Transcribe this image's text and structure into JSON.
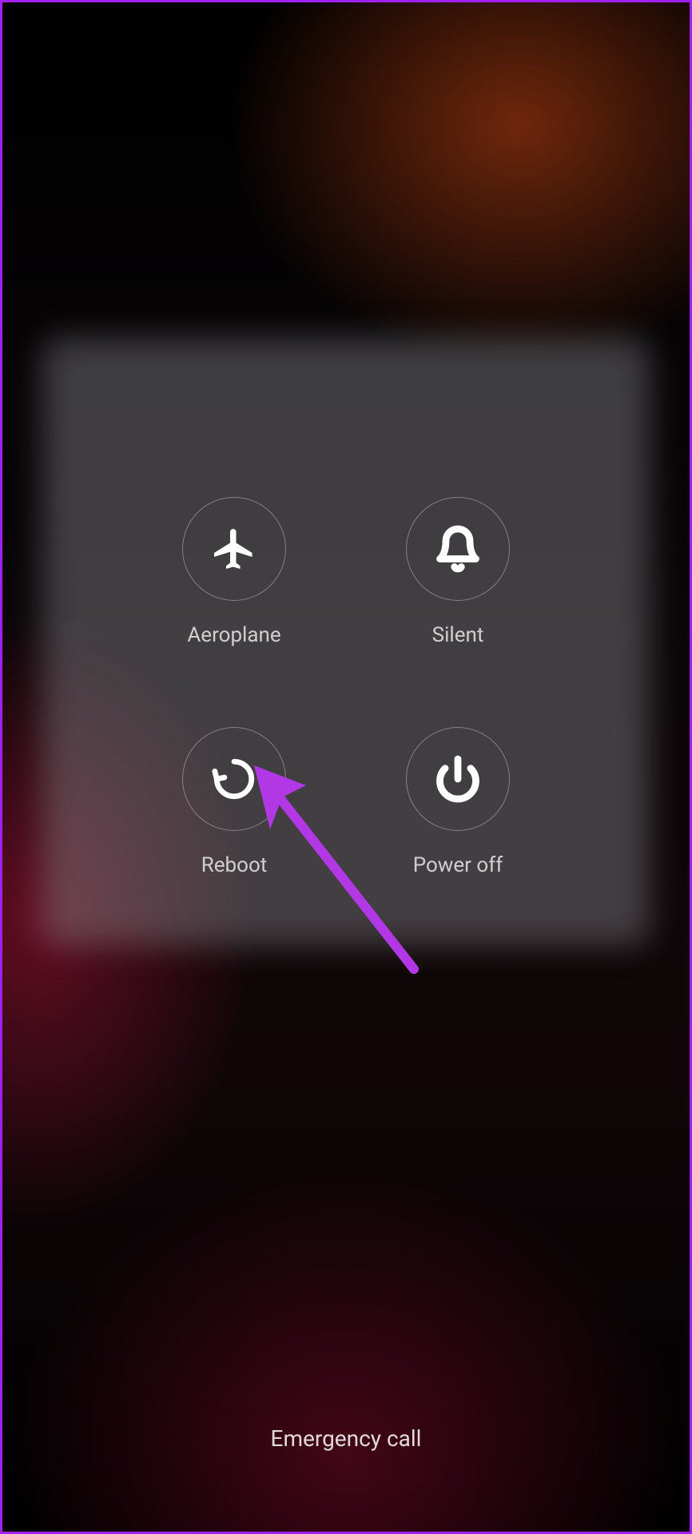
{
  "options": {
    "aeroplane": {
      "label": "Aeroplane",
      "icon": "airplane-icon"
    },
    "silent": {
      "label": "Silent",
      "icon": "bell-icon"
    },
    "reboot": {
      "label": "Reboot",
      "icon": "reboot-icon"
    },
    "poweroff": {
      "label": "Power off",
      "icon": "power-icon"
    }
  },
  "emergency": {
    "label": "Emergency call"
  },
  "annotation": {
    "target": "reboot",
    "color": "#b238e6"
  }
}
